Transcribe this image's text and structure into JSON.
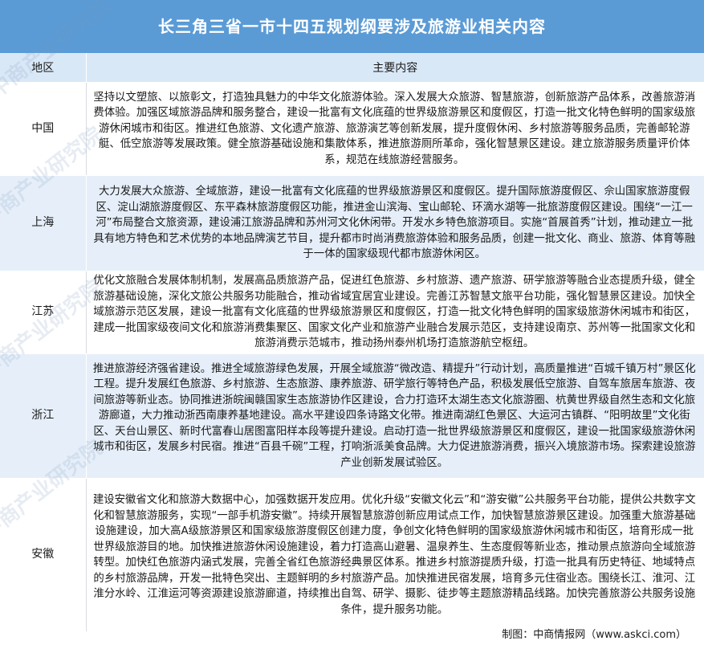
{
  "title": "长三角三省一市十四五规划纲要涉及旅游业相关内容",
  "table": {
    "headers": [
      "地区",
      "主要内容"
    ],
    "rows": [
      {
        "region": "中国",
        "content": "坚持以文塑旅、以旅彰文，打造独具魅力的中华文化旅游体验。深入发展大众旅游、智慧旅游，创新旅游产品体系，改善旅游消费体验。加强区域旅游品牌和服务整合，建设一批富有文化底蕴的世界级旅游景区和度假区，打造一批文化特色鲜明的国家级旅游休闲城市和街区。推进红色旅游、文化遗产旅游、旅游演艺等创新发展，提升度假休闲、乡村旅游等服务品质，完善邮轮游艇、低空旅游等发展政策。健全旅游基础设施和集散体系，推进旅游厕所革命，强化智慧景区建设。建立旅游服务质量评价体系，规范在线旅游经营服务。"
      },
      {
        "region": "上海",
        "content": "大力发展大众旅游、全域旅游，建设一批富有文化底蕴的世界级旅游景区和度假区。提升国际旅游度假区、佘山国家旅游度假区、淀山湖旅游度假区、东平森林旅游度假区功能，推进金山滨海、宝山邮轮、环滴水湖等一批旅游度假区建设。围绕“一江一河”布局整合文旅资源，建设浦江旅游品牌和苏州河文化休闲带。开发水乡特色旅游项目。实施“首展首秀”计划，推动建立一批具有地方特色和艺术优势的本地品牌演艺节目，提升都市时尚消费旅游体验和服务品质，创建一批文化、商业、旅游、体育等融于一体的国家级现代都市旅游休闲区。"
      },
      {
        "region": "江苏",
        "content": "优化文旅融合发展体制机制，发展高品质旅游产品，促进红色旅游、乡村旅游、遗产旅游、研学旅游等融合业态提质升级，健全旅游基础设施，深化文旅公共服务功能融合，推动省域宜居宜业建设。完善江苏智慧文旅平台功能，强化智慧景区建设。加快全域旅游示范区发展，建设一批富有文化底蕴的世界级旅游景区和度假区，打造一批文化特色鲜明的国家级旅游休闲城市和街区，建成一批国家级夜间文化和旅游消费集聚区、国家文化产业和旅游产业融合发展示范区，支持建设南京、苏州等一批国家文化和旅游消费示范城市，推动扬州泰州机场打造旅游航空枢纽。"
      },
      {
        "region": "浙江",
        "content": "推进旅游经济强省建设。推进全域旅游绿色发展，开展全域旅游“微改造、精提升”行动计划，高质量推进“百城千镇万村”景区化工程。提升发展红色旅游、乡村旅游、生态旅游、康养旅游、研学旅行等特色产品，积极发展低空旅游、自驾车旅居车旅游、夜间旅游等新业态。协同推进浙皖闽赣国家生态旅游协作区建设，合力打造环太湖生态文化旅游圈、杭黄世界级自然生态和文化旅游廊道，大力推动浙西南康养基地建设。高水平建设四条诗路文化带。推进南湖红色景区、大运河古镇群、“阳明故里”文化街区、天台山景区、新时代富春山居图富阳样本段等提升建设。启动打造一批世界级旅游景区和度假区，建设一批国家级旅游休闲城市和街区，发展乡村民宿。推进“百县千碗”工程，打响浙派美食品牌。大力促进旅游消费，振兴入境旅游市场。探索建设旅游产业创新发展试验区。"
      },
      {
        "region": "安徽",
        "content": "建设安徽省文化和旅游大数据中心，加强数据开发应用。优化升级“安徽文化云”和“游安徽”公共服务平台功能，提供公共数字文化和智慧旅游服务，实现“一部手机游安徽”。持续开展智慧旅游创新应用试点工作，加快智慧旅游景区建设。加强重大旅游基础设施建设，加大高A级旅游景区和国家级旅游度假区创建力度，争创文化特色鲜明的国家级旅游休闲城市和街区，培育形成一批世界级旅游目的地。加快推进旅游休闲设施建设，着力打造高山避暑、温泉养生、生态度假等新业态，推动景点旅游向全域旅游转型。加快红色旅游内涵式发展，完善全省红色旅游经典景区体系。推进乡村旅游提质升级，打造一批具有历史特征、地域特点的乡村旅游品牌，开发一批特色突出、主题鲜明的乡村旅游产品。加快推进民宿发展，培育多元住宿业态。围绕长江、淮河、江淮分水岭、江淮运河等资源建设旅游廊道，持续推出自驾、研学、摄影、徒步等主题旅游精品线路。加快完善旅游公共服务设施条件，提升服务功能。"
      }
    ]
  },
  "footer": "制图：中商情报网（www.askci.com）",
  "watermark": "中商产业研究院",
  "colors": {
    "title_bg": "#5a9bd6",
    "header_bg": "#d9e8f7",
    "band_bg": "#e6eff9"
  }
}
